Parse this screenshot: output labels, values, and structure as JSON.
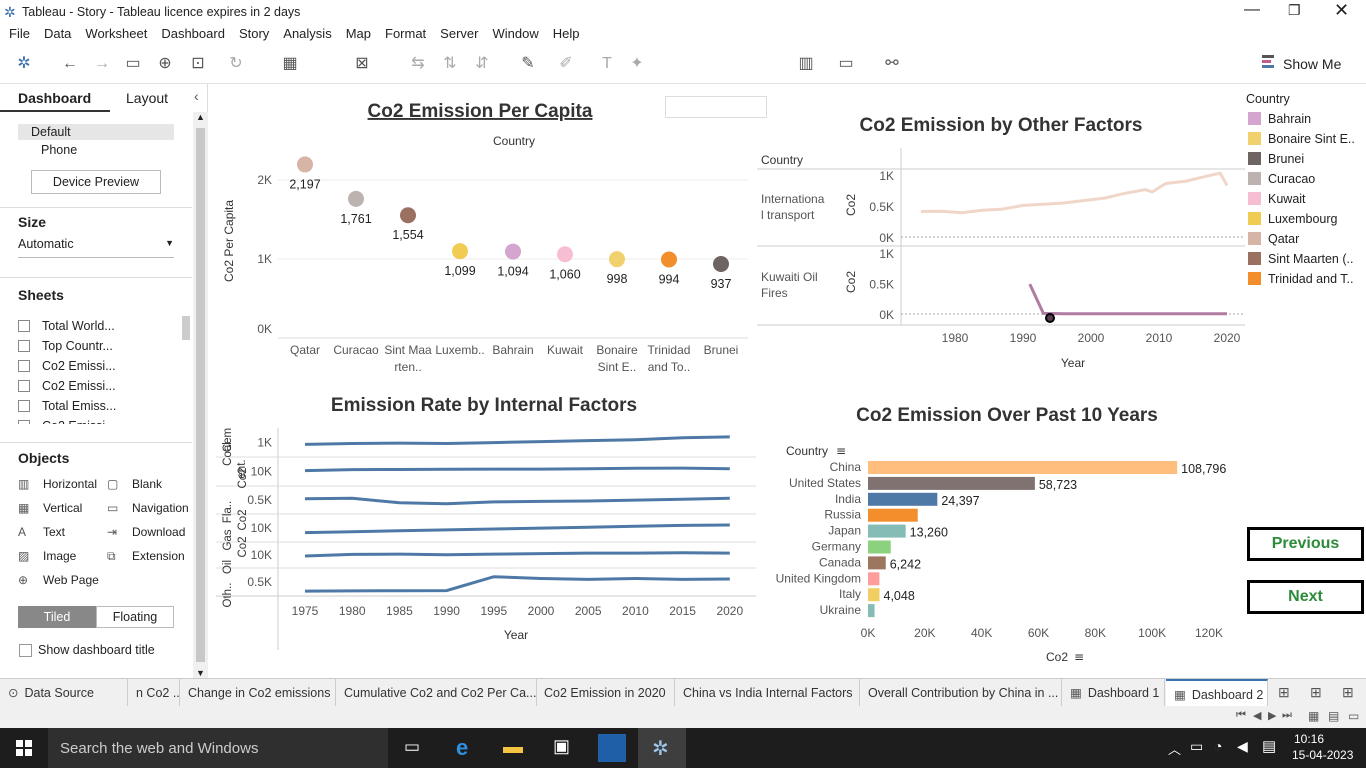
{
  "window": {
    "title": "Tableau - Story - Tableau licence expires in 2 days"
  },
  "menu": [
    "File",
    "Data",
    "Worksheet",
    "Dashboard",
    "Story",
    "Analysis",
    "Map",
    "Format",
    "Server",
    "Window",
    "Help"
  ],
  "toolbar": {
    "show_me": "Show Me"
  },
  "left": {
    "tab_dashboard": "Dashboard",
    "tab_layout": "Layout",
    "devices": [
      "Default",
      "Phone"
    ],
    "device_preview": "Device Preview",
    "size_label": "Size",
    "size_value": "Automatic",
    "sheets_label": "Sheets",
    "sheets": [
      "Total World...",
      "Top Countr...",
      "Co2 Emissi...",
      "Co2 Emissi...",
      "Total Emiss...",
      "Co2 Emissi..."
    ],
    "objects_label": "Objects",
    "objects": [
      "Horizontal",
      "Blank",
      "Vertical",
      "Navigation",
      "Text",
      "Download",
      "Image",
      "Extension",
      "Web Page"
    ],
    "tiled": "Tiled",
    "floating": "Floating",
    "show_title": "Show dashboard title"
  },
  "charts": {
    "per_capita": {
      "title": "Co2 Emission Per Capita",
      "header": "Country",
      "ylabel": "Co2 Per Capita",
      "ticks": [
        "2K",
        "1K",
        "0K"
      ]
    },
    "other": {
      "title": "Co2 Emission by Other Factors",
      "header": "Country",
      "rows": [
        "Internationa l transport",
        "Kuwaiti Oil Fires"
      ],
      "ylabel": "Co2",
      "ticks": [
        "1K",
        "0.5K",
        "0K"
      ],
      "xlabel": "Year",
      "xticks": [
        "1980",
        "1990",
        "2000",
        "2010",
        "2020"
      ]
    },
    "internal": {
      "title": "Emission Rate by Internal Factors",
      "rows": [
        "Coal",
        "Cem ent..",
        "Fla..",
        "Gas",
        "Oil",
        "Oth.."
      ],
      "axis_labels": [
        "Co2",
        "Co2",
        "Co2"
      ],
      "ticks": [
        "1K",
        "10K",
        "0.5K",
        "10K",
        "10K",
        "0.5K"
      ],
      "xlabel": "Year",
      "xticks": [
        "1975",
        "1980",
        "1985",
        "1990",
        "1995",
        "2000",
        "2005",
        "2010",
        "2015",
        "2020"
      ]
    },
    "past10": {
      "title": "Co2 Emission Over Past 10 Years",
      "header": "Country",
      "xlabel": "Co2",
      "xticks": [
        "0K",
        "20K",
        "40K",
        "60K",
        "80K",
        "100K",
        "120K"
      ]
    }
  },
  "legend": {
    "title": "Country",
    "items": [
      {
        "name": "Bahrain",
        "color": "#d3a5cf"
      },
      {
        "name": "Bonaire Sint E..",
        "color": "#f0d16d"
      },
      {
        "name": "Brunei",
        "color": "#6e6461"
      },
      {
        "name": "Curacao",
        "color": "#bcb3b0"
      },
      {
        "name": "Kuwait",
        "color": "#f7bed3"
      },
      {
        "name": "Luxembourg",
        "color": "#f1cc52"
      },
      {
        "name": "Qatar",
        "color": "#d6b4a6"
      },
      {
        "name": "Sint Maarten (..",
        "color": "#9a7060"
      },
      {
        "name": "Trinidad and T..",
        "color": "#f28e2b"
      }
    ]
  },
  "nav": {
    "previous": "Previous",
    "next": "Next"
  },
  "tabs": [
    "Data Source",
    "n Co2 ...",
    "Change in Co2 emissions",
    "Cumulative Co2 and Co2  Per Ca...",
    "Co2 Emission in 2020",
    "China vs India Internal Factors",
    "Overall Contribution by China in ...",
    "Dashboard 1",
    "Dashboard 2"
  ],
  "taskbar": {
    "search": "Search the web and Windows",
    "time": "10:16",
    "date": "15-04-2023"
  },
  "chart_data": [
    {
      "type": "scatter",
      "title": "Co2 Emission Per Capita",
      "xlabel": "Country",
      "ylabel": "Co2 Per Capita",
      "ylim": [
        0,
        2300
      ],
      "categories": [
        "Qatar",
        "Curacao",
        "Sint Maa rten..",
        "Luxemb..",
        "Bahrain",
        "Kuwait",
        "Bonaire Sint E..",
        "Trinidad and To..",
        "Brunei"
      ],
      "values": [
        2197,
        1761,
        1554,
        1099,
        1094,
        1060,
        998,
        994,
        937
      ],
      "labels": [
        "2,197",
        "1,761",
        "1,554",
        "1,099",
        "1,094",
        "1,060",
        "998",
        "994",
        "937"
      ],
      "colors": [
        "#d6b4a6",
        "#bcb3b0",
        "#9a7060",
        "#f1cc52",
        "#d3a5cf",
        "#f7bed3",
        "#f0d16d",
        "#f28e2b",
        "#6e6461"
      ]
    },
    {
      "type": "line",
      "title": "Co2 Emission by Other Factors",
      "xlabel": "Year",
      "ylabel": "Co2",
      "xlim": [
        1970,
        2023
      ],
      "series": [
        {
          "name": "Internationa l transport",
          "color": "#f0d6c8",
          "points": [
            [
              1975,
              420
            ],
            [
              1978,
              425
            ],
            [
              1981,
              400
            ],
            [
              1984,
              440
            ],
            [
              1987,
              460
            ],
            [
              1990,
              520
            ],
            [
              1993,
              540
            ],
            [
              1996,
              560
            ],
            [
              1999,
              600
            ],
            [
              2002,
              640
            ],
            [
              2005,
              720
            ],
            [
              2008,
              780
            ],
            [
              2009,
              740
            ],
            [
              2011,
              880
            ],
            [
              2014,
              920
            ],
            [
              2017,
              1000
            ],
            [
              2019,
              1050
            ],
            [
              2020,
              850
            ]
          ]
        },
        {
          "name": "Kuwaiti Oil Fires",
          "color": "#b07aa1",
          "points": [
            [
              1991,
              500
            ],
            [
              1993,
              10
            ],
            [
              1996,
              5
            ],
            [
              2000,
              5
            ],
            [
              2010,
              5
            ],
            [
              2020,
              5
            ]
          ]
        }
      ]
    },
    {
      "type": "line",
      "title": "Emission Rate by Internal Factors",
      "xlabel": "Year",
      "xlim": [
        1975,
        2020
      ],
      "series": [
        {
          "name": "Coal",
          "values": [
            0.45,
            0.5,
            0.52,
            0.5,
            0.55,
            0.6,
            0.65,
            0.7,
            0.8,
            0.85
          ]
        },
        {
          "name": "Cem ent..",
          "values": [
            0.6,
            0.65,
            0.66,
            0.67,
            0.68,
            0.68,
            0.7,
            0.72,
            0.73,
            0.7
          ]
        },
        {
          "name": "Fla..",
          "values": [
            0.62,
            0.65,
            0.4,
            0.35,
            0.45,
            0.48,
            0.5,
            0.55,
            0.6,
            0.65
          ]
        },
        {
          "name": "Gas",
          "values": [
            0.3,
            0.35,
            0.4,
            0.45,
            0.5,
            0.55,
            0.6,
            0.65,
            0.7,
            0.72
          ]
        },
        {
          "name": "Oil",
          "values": [
            0.5,
            0.6,
            0.62,
            0.58,
            0.62,
            0.65,
            0.68,
            0.68,
            0.7,
            0.68
          ]
        },
        {
          "name": "Oth..",
          "values": [
            0.05,
            0.06,
            0.07,
            0.08,
            0.85,
            0.75,
            0.7,
            0.75,
            0.7,
            0.72
          ]
        }
      ]
    },
    {
      "type": "bar",
      "title": "Co2 Emission Over Past 10 Years",
      "xlabel": "Co2",
      "ylabel": "Country",
      "xlim": [
        0,
        125000
      ],
      "categories": [
        "China",
        "United States",
        "India",
        "Russia",
        "Japan",
        "Germany",
        "Canada",
        "United Kingdom",
        "Italy",
        "Ukraine"
      ],
      "values": [
        108796,
        58723,
        24397,
        17500,
        13260,
        8000,
        6242,
        4000,
        4048,
        2300
      ],
      "labels": [
        "108,796",
        "58,723",
        "24,397",
        "",
        "13,260",
        "",
        "6,242",
        "",
        "4,048",
        ""
      ],
      "colors": [
        "#ffbe7d",
        "#7f7270",
        "#4e79a7",
        "#f28e2b",
        "#86bcb6",
        "#8cd17d",
        "#9d7660",
        "#ff9d9a",
        "#f1ce63",
        "#86bcb6"
      ]
    }
  ]
}
